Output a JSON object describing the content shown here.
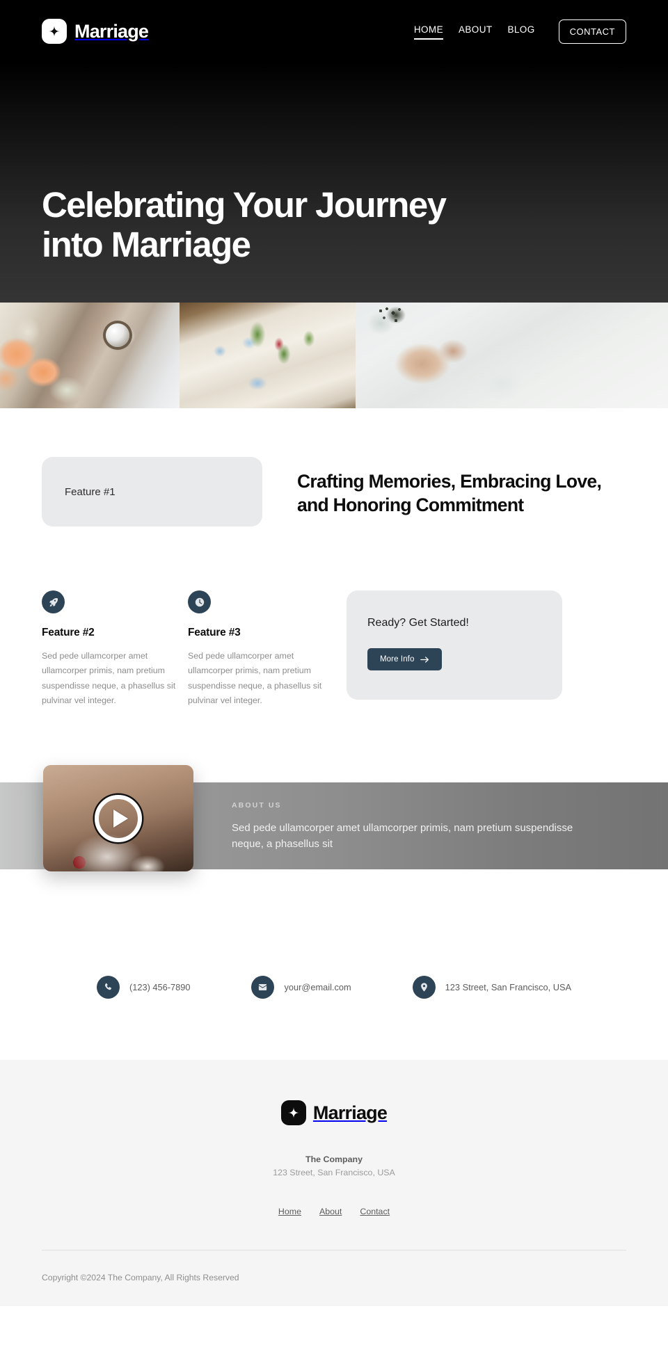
{
  "header": {
    "logo_icon": "pinwheel-logo-icon",
    "brand": "Marriage",
    "nav": [
      {
        "label": "HOME",
        "active": true
      },
      {
        "label": "ABOUT",
        "active": false
      },
      {
        "label": "BLOG",
        "active": false
      }
    ],
    "contact_button": "CONTACT"
  },
  "hero": {
    "title": "Celebrating Your Journey into Marriage",
    "background_start": "#000000",
    "background_end": "#343434"
  },
  "gallery": {
    "images": [
      {
        "alt": "couple-hands-with-rings-and-peach-roses"
      },
      {
        "alt": "reception-table-with-florals-and-glassware"
      },
      {
        "alt": "hands-held-with-winter-florals"
      }
    ]
  },
  "features": {
    "card_label": "Feature #1",
    "heading": "Crafting Memories, Embracing Love, and Honoring Commitment",
    "columns": [
      {
        "icon": "rocket-icon",
        "title": "Feature #2",
        "body": "Sed pede ullamcorper amet ullamcorper primis, nam pretium suspendisse neque, a phasellus sit pulvinar vel integer."
      },
      {
        "icon": "clock-icon",
        "title": "Feature #3",
        "body": "Sed pede ullamcorper amet ullamcorper primis, nam pretium suspendisse neque, a phasellus sit pulvinar vel integer."
      }
    ],
    "cta": {
      "title": "Ready? Get Started!",
      "button_label": "More Info",
      "button_icon": "arrow-right-icon",
      "button_color": "#2d4356"
    }
  },
  "about": {
    "kicker": "ABOUT US",
    "body": "Sed pede ullamcorper amet ullamcorper primis, nam pretium suspendisse neque, a phasellus sit",
    "video_alt": "wedding-cake-topper-video-thumbnail",
    "play_icon": "play-icon"
  },
  "contact": [
    {
      "icon": "phone-icon",
      "text": "(123) 456-7890"
    },
    {
      "icon": "envelope-icon",
      "text": "your@email.com"
    },
    {
      "icon": "map-pin-icon",
      "text": "123 Street, San Francisco, USA"
    }
  ],
  "footer": {
    "logo_icon": "pinwheel-logo-icon",
    "brand": "Marriage",
    "company": "The Company",
    "address": "123 Street, San Francisco, USA",
    "links": [
      "Home",
      "About",
      "Contact"
    ],
    "copyright": "Copyright ©2024 The Company, All Rights Reserved"
  },
  "theme": {
    "accent": "#2d4356",
    "dark": "#000000",
    "card_bg": "#e9eaeb",
    "footer_bg": "#f5f5f5"
  }
}
